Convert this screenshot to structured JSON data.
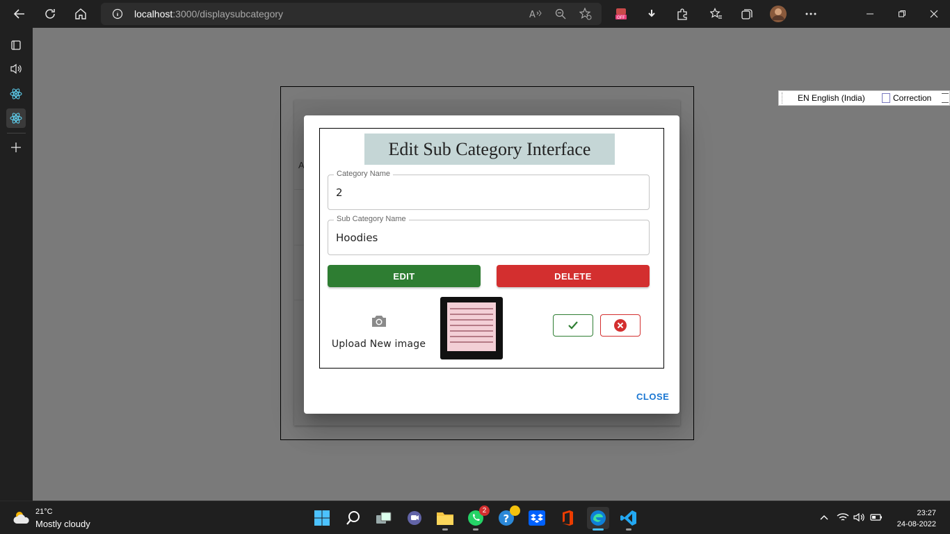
{
  "browser": {
    "url_host": "localhost",
    "url_path": ":3000/displaysubcategory"
  },
  "language_bar": {
    "language": "EN English (India)",
    "correction": "Correction"
  },
  "background_page": {
    "partial_letter": "A"
  },
  "dialog": {
    "title": "Edit Sub Category Interface",
    "category_field": {
      "label": "Category Name",
      "value": "2"
    },
    "subcategory_field": {
      "label": "Sub Category Name",
      "value": "Hoodies"
    },
    "edit_label": "EDIT",
    "delete_label": "DELETE",
    "upload_label": "Upload New image",
    "close_label": "CLOSE"
  },
  "taskbar": {
    "weather": {
      "temp": "21°C",
      "condition": "Mostly cloudy"
    },
    "whatsapp_badge": "2",
    "time": "23:27",
    "date": "24-08-2022"
  },
  "colors": {
    "edit": "#2e7d32",
    "delete": "#d32f2f",
    "close": "#1976d2",
    "title_bg": "#c5d6d6"
  }
}
